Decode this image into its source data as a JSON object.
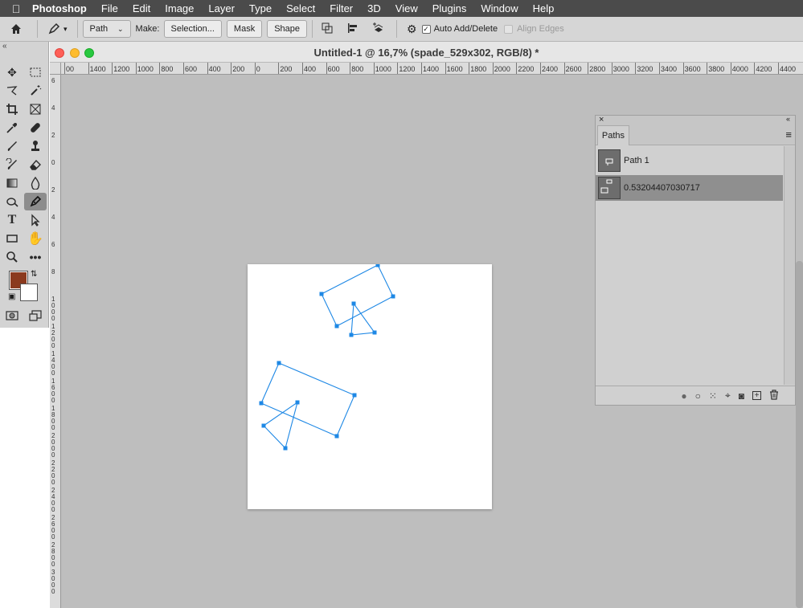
{
  "menubar": {
    "apple_icon": "apple-logo-icon",
    "app_name": "Photoshop",
    "items": [
      "File",
      "Edit",
      "Image",
      "Layer",
      "Type",
      "Select",
      "Filter",
      "3D",
      "View",
      "Plugins",
      "Window",
      "Help"
    ]
  },
  "options_bar": {
    "mode_select": "Path",
    "make_label": "Make:",
    "selection_btn": "Selection...",
    "mask_btn": "Mask",
    "shape_btn": "Shape",
    "auto_add_delete": "Auto Add/Delete",
    "auto_add_delete_checked": true,
    "align_edges": "Align Edges",
    "align_edges_checked": false
  },
  "tools": {
    "collapse_icon": "«",
    "foreground_color": "#8b3a1e",
    "background_color": "#ffffff"
  },
  "document": {
    "title": "Untitled-1 @ 16,7% (spade_529x302, RGB/8) *",
    "h_ruler_ticks": [
      "00",
      "1400",
      "1200",
      "1000",
      "800",
      "600",
      "400",
      "200",
      "0",
      "200",
      "400",
      "600",
      "800",
      "1000",
      "1200",
      "1400",
      "1600",
      "1800",
      "2000",
      "2200",
      "2400",
      "2600",
      "2800",
      "3000",
      "3200",
      "3400",
      "3600",
      "3800",
      "4000",
      "4200",
      "4400"
    ],
    "v_ruler_ticks": [
      "6",
      "4",
      "2",
      "0",
      "2",
      "4",
      "6",
      "8",
      "1000",
      "1200",
      "1400",
      "1600",
      "1800",
      "2000",
      "2200",
      "2400",
      "2600",
      "2800",
      "3000"
    ],
    "path_color": "#1e88e5"
  },
  "paths_panel": {
    "close_icon": "×",
    "collapse_icon": "«",
    "tab_label": "Paths",
    "menu_icon": "≡",
    "rows": [
      {
        "name": "Path 1",
        "selected": false
      },
      {
        "name": "0.53204407030717",
        "selected": true
      }
    ],
    "footer_icons": [
      "●",
      "○",
      "⁙",
      "⌖",
      "◙",
      "+",
      "🗑"
    ]
  }
}
